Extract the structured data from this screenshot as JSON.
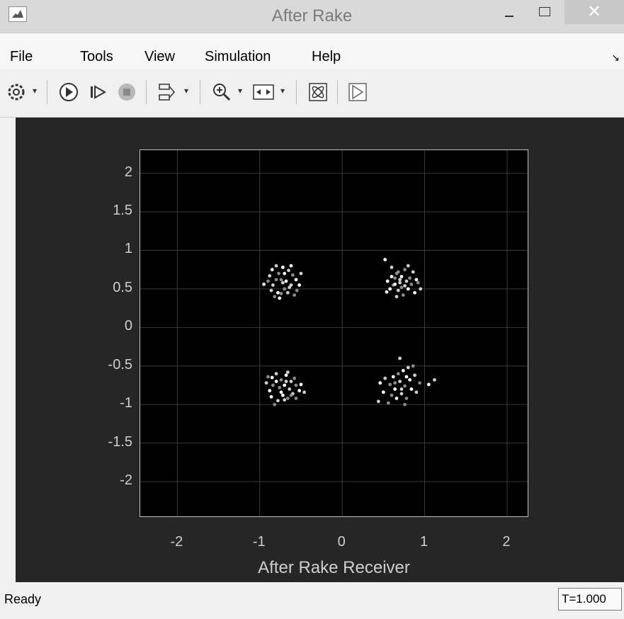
{
  "window": {
    "title": "After Rake"
  },
  "menu": [
    "File",
    "Tools",
    "View",
    "Simulation",
    "Help"
  ],
  "status": {
    "text": "Ready",
    "time": "T=1.000"
  },
  "chart_data": {
    "type": "scatter",
    "title": "",
    "xlabel": "After Rake Receiver",
    "ylabel": "",
    "xlim": [
      -2.45,
      2.25
    ],
    "ylim": [
      -2.45,
      2.3
    ],
    "xticks": [
      "-2",
      "-1",
      "0",
      "1",
      "2"
    ],
    "yticks": [
      "2",
      "1.5",
      "1",
      "0.5",
      "0",
      "-0.5",
      "-1",
      "-1.5",
      "-2"
    ],
    "grid": true,
    "background": "#000000",
    "clusters": [
      {
        "cx": -0.72,
        "cy": 0.62
      },
      {
        "cx": 0.7,
        "cy": 0.62
      },
      {
        "cx": -0.72,
        "cy": -0.77
      },
      {
        "cx": 0.7,
        "cy": -0.76
      }
    ],
    "points": [
      [
        -0.85,
        0.75
      ],
      [
        -0.8,
        0.8
      ],
      [
        -0.77,
        0.7
      ],
      [
        -0.72,
        0.78
      ],
      [
        -0.65,
        0.74
      ],
      [
        -0.6,
        0.68
      ],
      [
        -0.56,
        0.62
      ],
      [
        -0.62,
        0.55
      ],
      [
        -0.7,
        0.5
      ],
      [
        -0.78,
        0.45
      ],
      [
        -0.84,
        0.55
      ],
      [
        -0.9,
        0.6
      ],
      [
        -0.95,
        0.56
      ],
      [
        -0.88,
        0.67
      ],
      [
        -0.74,
        0.62
      ],
      [
        -0.68,
        0.6
      ],
      [
        -0.66,
        0.45
      ],
      [
        -0.58,
        0.42
      ],
      [
        -0.52,
        0.55
      ],
      [
        -0.5,
        0.7
      ],
      [
        -0.82,
        0.4
      ],
      [
        -0.76,
        0.38
      ],
      [
        -0.72,
        0.58
      ],
      [
        -0.8,
        0.62
      ],
      [
        -0.7,
        0.7
      ],
      [
        -0.64,
        0.52
      ],
      [
        -0.55,
        0.48
      ],
      [
        -0.62,
        0.8
      ],
      [
        -0.86,
        0.48
      ],
      [
        -0.74,
        0.44
      ],
      [
        0.52,
        0.88
      ],
      [
        0.6,
        0.78
      ],
      [
        0.66,
        0.7
      ],
      [
        0.72,
        0.66
      ],
      [
        0.78,
        0.6
      ],
      [
        0.84,
        0.56
      ],
      [
        0.9,
        0.62
      ],
      [
        0.95,
        0.5
      ],
      [
        0.62,
        0.55
      ],
      [
        0.55,
        0.6
      ],
      [
        0.68,
        0.48
      ],
      [
        0.74,
        0.42
      ],
      [
        0.8,
        0.5
      ],
      [
        0.7,
        0.58
      ],
      [
        0.64,
        0.64
      ],
      [
        0.58,
        0.5
      ],
      [
        0.86,
        0.72
      ],
      [
        0.76,
        0.75
      ],
      [
        0.88,
        0.45
      ],
      [
        0.66,
        0.4
      ],
      [
        0.72,
        0.52
      ],
      [
        0.6,
        0.66
      ],
      [
        0.8,
        0.8
      ],
      [
        0.92,
        0.58
      ],
      [
        0.54,
        0.46
      ],
      [
        0.7,
        0.62
      ],
      [
        0.82,
        0.64
      ],
      [
        0.64,
        0.56
      ],
      [
        0.76,
        0.54
      ],
      [
        0.68,
        0.72
      ],
      [
        -0.85,
        -0.65
      ],
      [
        -0.8,
        -0.6
      ],
      [
        -0.74,
        -0.68
      ],
      [
        -0.68,
        -0.62
      ],
      [
        -0.62,
        -0.7
      ],
      [
        -0.56,
        -0.75
      ],
      [
        -0.52,
        -0.82
      ],
      [
        -0.6,
        -0.86
      ],
      [
        -0.66,
        -0.92
      ],
      [
        -0.72,
        -0.88
      ],
      [
        -0.78,
        -0.95
      ],
      [
        -0.82,
        -1.0
      ],
      [
        -0.88,
        -0.82
      ],
      [
        -0.92,
        -0.72
      ],
      [
        -0.76,
        -0.78
      ],
      [
        -0.7,
        -0.75
      ],
      [
        -0.64,
        -0.8
      ],
      [
        -0.58,
        -0.66
      ],
      [
        -0.5,
        -0.74
      ],
      [
        -0.46,
        -0.84
      ],
      [
        -0.84,
        -0.75
      ],
      [
        -0.74,
        -0.84
      ],
      [
        -0.68,
        -0.7
      ],
      [
        -0.62,
        -0.88
      ],
      [
        -0.8,
        -0.7
      ],
      [
        -0.7,
        -0.94
      ],
      [
        -0.56,
        -0.92
      ],
      [
        -0.86,
        -0.9
      ],
      [
        -0.66,
        -0.58
      ],
      [
        -0.9,
        -0.64
      ],
      [
        0.46,
        -0.72
      ],
      [
        0.52,
        -0.66
      ],
      [
        0.58,
        -0.74
      ],
      [
        0.64,
        -0.8
      ],
      [
        0.7,
        -0.7
      ],
      [
        0.76,
        -0.76
      ],
      [
        0.82,
        -0.68
      ],
      [
        0.88,
        -0.62
      ],
      [
        0.94,
        -0.72
      ],
      [
        1.05,
        -0.74
      ],
      [
        1.12,
        -0.68
      ],
      [
        0.6,
        -0.88
      ],
      [
        0.66,
        -0.92
      ],
      [
        0.72,
        -0.86
      ],
      [
        0.78,
        -0.92
      ],
      [
        0.5,
        -0.84
      ],
      [
        0.44,
        -0.96
      ],
      [
        0.56,
        -0.98
      ],
      [
        0.84,
        -0.8
      ],
      [
        0.9,
        -0.84
      ],
      [
        0.68,
        -0.6
      ],
      [
        0.74,
        -0.56
      ],
      [
        0.8,
        -0.52
      ],
      [
        0.86,
        -0.5
      ],
      [
        0.62,
        -0.64
      ],
      [
        0.72,
        -0.8
      ],
      [
        0.64,
        -0.72
      ],
      [
        0.78,
        -0.64
      ],
      [
        0.7,
        -0.4
      ],
      [
        0.76,
        -1.0
      ]
    ]
  }
}
